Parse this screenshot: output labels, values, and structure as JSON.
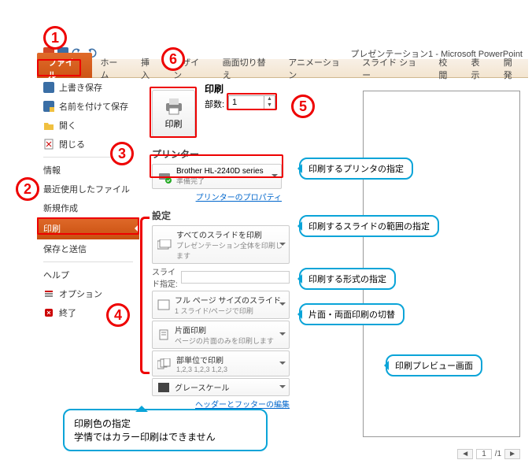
{
  "title": "プレゼンテーション1 - Microsoft PowerPoint",
  "ribbon": {
    "file": "ファイル",
    "tabs": [
      "ホーム",
      "挿入",
      "デザイン",
      "画面切り替え",
      "アニメーション",
      "スライド ショー",
      "校閲",
      "表示",
      "開発"
    ]
  },
  "backstage": {
    "save": "上書き保存",
    "saveas": "名前を付けて保存",
    "open": "開く",
    "close": "閉じる",
    "info": "情報",
    "recent": "最近使用したファイル",
    "new": "新規作成",
    "print": "印刷",
    "share": "保存と送信",
    "help": "ヘルプ",
    "options": "オプション",
    "exit": "終了"
  },
  "print": {
    "header": "印刷",
    "button": "印刷",
    "copies_label": "部数:",
    "copies_value": "1",
    "printer_header": "プリンター",
    "printer_name": "Brother HL-2240D series",
    "printer_status": "準備完了",
    "printer_props": "プリンターのプロパティ",
    "settings_header": "設定",
    "scope_t": "すべてのスライドを印刷",
    "scope_s": "プレゼンテーション全体を印刷します",
    "slide_spec": "スライド指定:",
    "layout_t": "フル ページ サイズのスライド",
    "layout_s": "1 スライド/ページで印刷",
    "side_t": "片面印刷",
    "side_s": "ページの片面のみを印刷します",
    "collate_t": "部単位で印刷",
    "collate_s": "1,2,3   1,2,3   1,2,3",
    "color_t": "グレースケール",
    "hf": "ヘッダーとフッターの編集"
  },
  "pager": {
    "cur": "1",
    "total": "/1"
  },
  "callouts": {
    "c_printer": "印刷するプリンタの指定",
    "c_scope": "印刷するスライドの範囲の指定",
    "c_layout": "印刷する形式の指定",
    "c_side": "片面・両面印刷の切替",
    "c_preview": "印刷プレビュー画面",
    "note1": "印刷色の指定",
    "note2": "学情ではカラー印刷はできません"
  },
  "markers": {
    "m1": "1",
    "m2": "2",
    "m3": "3",
    "m4": "4",
    "m5": "5",
    "m6": "6"
  }
}
